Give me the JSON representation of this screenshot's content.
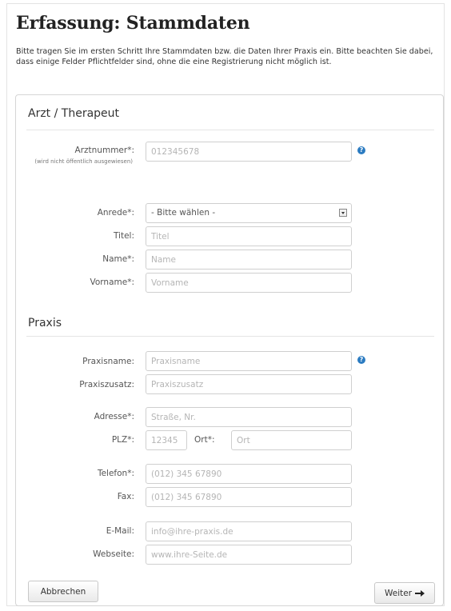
{
  "page": {
    "title": "Erfassung: Stammdaten",
    "intro": "Bitte tragen Sie im ersten Schritt Ihre Stammdaten bzw. die Daten Ihrer Praxis ein. Bitte beachten Sie dabei, dass einige Felder Pflichtfelder sind, ohne die eine Registrierung nicht möglich ist."
  },
  "arzt": {
    "title": "Arzt / Therapeut",
    "arztnummer": {
      "label": "Arztnummer*:",
      "note": "(wird nicht öffentlich ausgewiesen)",
      "placeholder": "012345678"
    },
    "anrede": {
      "label": "Anrede*:",
      "selected": "- Bitte wählen -"
    },
    "titel": {
      "label": "Titel:",
      "placeholder": "Titel"
    },
    "name": {
      "label": "Name*:",
      "placeholder": "Name"
    },
    "vorname": {
      "label": "Vorname*:",
      "placeholder": "Vorname"
    }
  },
  "praxis": {
    "title": "Praxis",
    "praxisname": {
      "label": "Praxisname:",
      "placeholder": "Praxisname"
    },
    "praxiszusatz": {
      "label": "Praxiszusatz:",
      "placeholder": "Praxiszusatz"
    },
    "adresse": {
      "label": "Adresse*:",
      "placeholder": "Straße, Nr."
    },
    "plz": {
      "label": "PLZ*:",
      "placeholder": "12345"
    },
    "ort": {
      "label": "Ort*:",
      "placeholder": "Ort"
    },
    "telefon": {
      "label": "Telefon*:",
      "placeholder": "(012) 345 67890"
    },
    "fax": {
      "label": "Fax:",
      "placeholder": "(012) 345 67890"
    },
    "email": {
      "label": "E-Mail:",
      "placeholder": "info@ihre-praxis.de"
    },
    "webseite": {
      "label": "Webseite:",
      "placeholder": "www.ihre-Seite.de"
    }
  },
  "buttons": {
    "cancel": "Abbrechen",
    "next": "Weiter"
  },
  "icons": {
    "help": "help-icon",
    "next": "arrow-right-icon",
    "dropdown": "dropdown-arrow-icon"
  },
  "colors": {
    "help_icon": "#2b7bc1",
    "border": "#cfcfcf"
  }
}
